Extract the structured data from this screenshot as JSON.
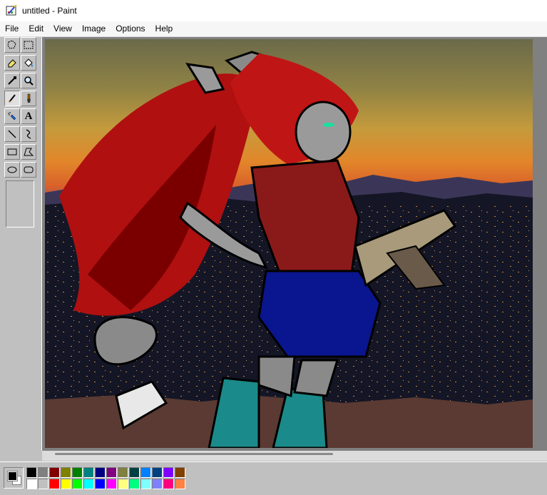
{
  "window": {
    "title": "untitled - Paint"
  },
  "menu": [
    {
      "label": "File"
    },
    {
      "label": "Edit"
    },
    {
      "label": "View"
    },
    {
      "label": "Image"
    },
    {
      "label": "Options"
    },
    {
      "label": "Help"
    }
  ],
  "tools": [
    {
      "name": "free-form-select-tool-icon"
    },
    {
      "name": "rect-select-tool-icon"
    },
    {
      "name": "eraser-tool-icon"
    },
    {
      "name": "fill-tool-icon"
    },
    {
      "name": "color-picker-tool-icon"
    },
    {
      "name": "magnifier-tool-icon"
    },
    {
      "name": "pencil-tool-icon",
      "active": true
    },
    {
      "name": "brush-tool-icon"
    },
    {
      "name": "airbrush-tool-icon"
    },
    {
      "name": "text-tool-icon",
      "glyph": "A"
    },
    {
      "name": "line-tool-icon"
    },
    {
      "name": "curve-tool-icon"
    },
    {
      "name": "rectangle-tool-icon"
    },
    {
      "name": "polygon-tool-icon"
    },
    {
      "name": "ellipse-tool-icon"
    },
    {
      "name": "rounded-rectangle-tool-icon"
    }
  ],
  "colors": {
    "foreground": "#000000",
    "background": "#ffffff",
    "palette_top": [
      "#000000",
      "#808080",
      "#800000",
      "#808000",
      "#008000",
      "#008080",
      "#000080",
      "#800080",
      "#808040",
      "#004040",
      "#0080ff",
      "#004080",
      "#8000ff",
      "#804000"
    ],
    "palette_bottom": [
      "#ffffff",
      "#c0c0c0",
      "#ff0000",
      "#ffff00",
      "#00ff00",
      "#00ffff",
      "#0000ff",
      "#ff00ff",
      "#ffff80",
      "#00ff80",
      "#80ffff",
      "#8080ff",
      "#ff0080",
      "#ff8040"
    ]
  }
}
